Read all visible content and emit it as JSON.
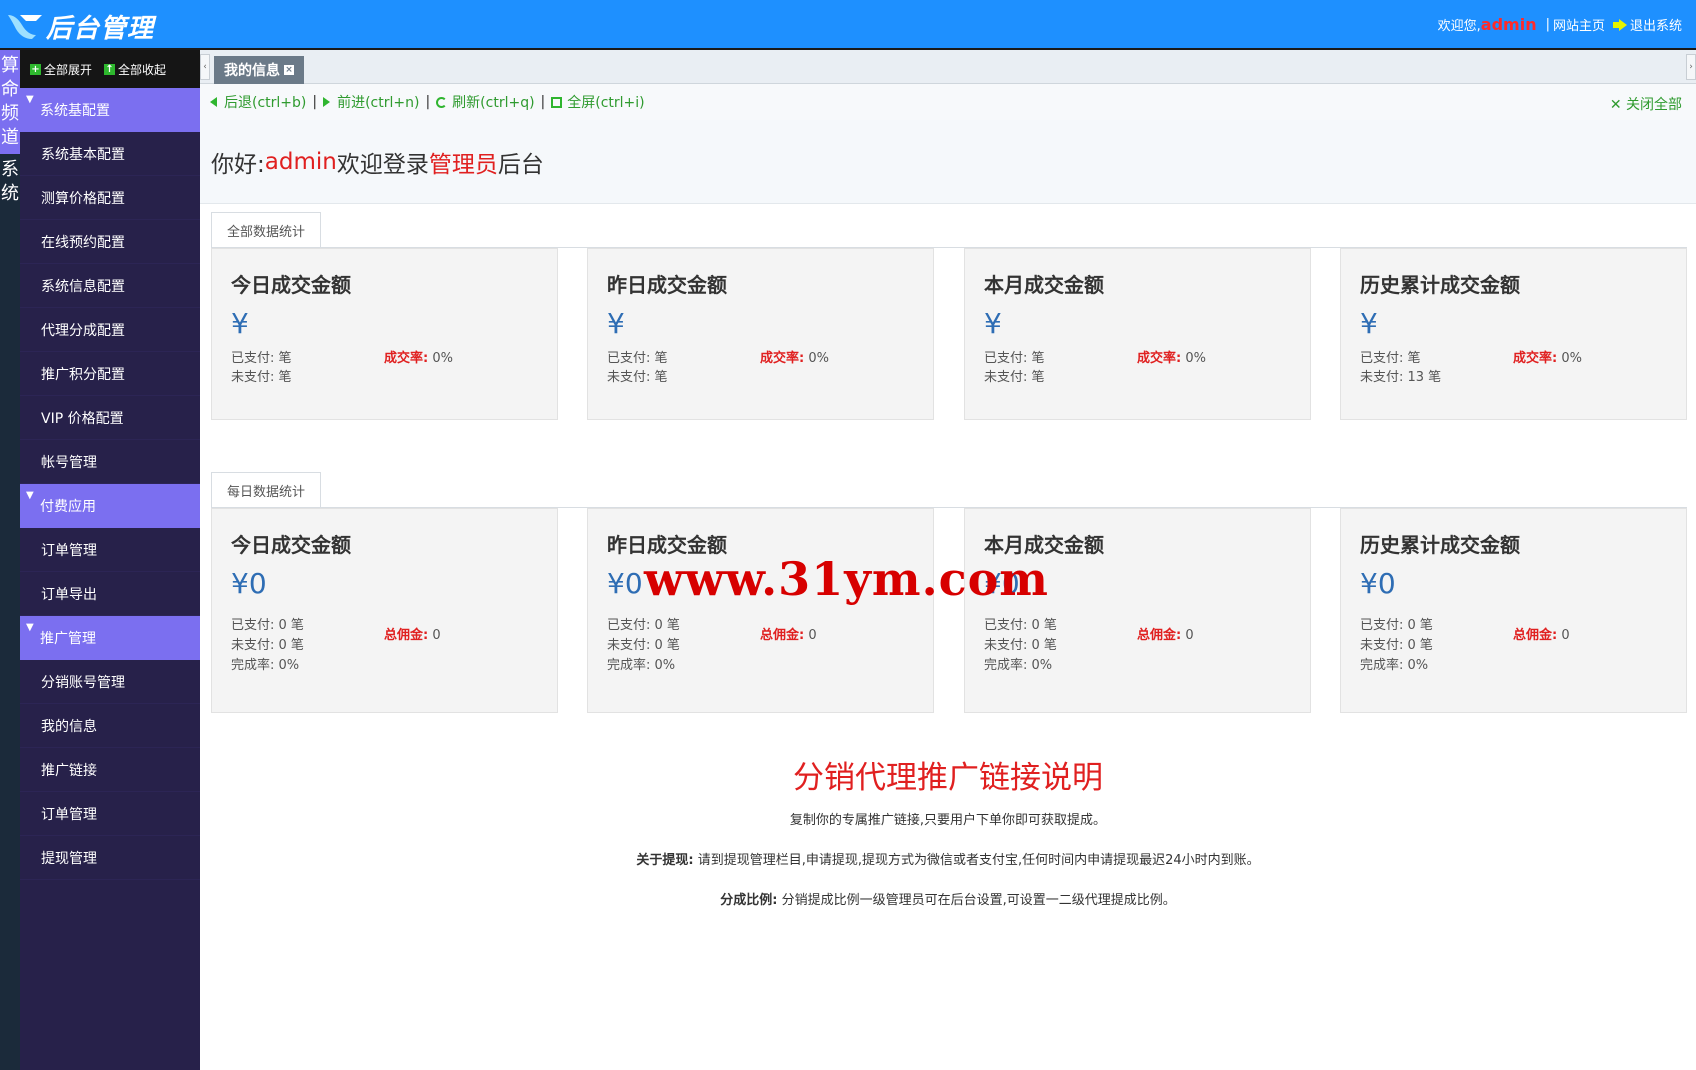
{
  "header": {
    "logo_text": "后台管理",
    "welcome_label": "欢迎您,",
    "username": "admin",
    "separator": "|",
    "home_link": "网站主页",
    "logout": "退出系统",
    "bg_color": "#1e90ff"
  },
  "vertical_tabs": [
    {
      "label": "算命频道",
      "active": true
    },
    {
      "label": "系统",
      "active": false
    }
  ],
  "sidebar": {
    "expand_all": "全部展开",
    "collapse_all": "全部收起",
    "groups": [
      {
        "title": "系统基配置",
        "items": [
          "系统基本配置",
          "测算价格配置",
          "在线预约配置",
          "系统信息配置",
          "代理分成配置",
          "推广积分配置",
          "VIP 价格配置",
          "帐号管理"
        ]
      },
      {
        "title": "付费应用",
        "items": [
          "订单管理",
          "订单导出"
        ]
      },
      {
        "title": "推广管理",
        "items": [
          "分销账号管理",
          "我的信息",
          "推广链接",
          "订单管理",
          "提现管理"
        ]
      }
    ]
  },
  "tabs": [
    {
      "label": "我的信息",
      "close": "×"
    }
  ],
  "toolbar": {
    "back": "后退(ctrl+b)",
    "forward": "前进(ctrl+n)",
    "refresh": "刷新(ctrl+q)",
    "fullscreen": "全屏(ctrl+i)",
    "close_all": "关闭全部",
    "bar": "|"
  },
  "welcome": {
    "prefix": "你好:",
    "user": "admin",
    "middle": "欢迎登录",
    "role": "管理员",
    "suffix": "后台"
  },
  "stats_all": {
    "tab": "全部数据统计",
    "cards": [
      {
        "title": "今日成交金额",
        "amount": "¥",
        "paid": "已支付: 笔",
        "unpaid": "未支付: 笔",
        "rate_label": "成交率:",
        "rate_value": " 0%"
      },
      {
        "title": "昨日成交金额",
        "amount": "¥",
        "paid": "已支付: 笔",
        "unpaid": "未支付: 笔",
        "rate_label": "成交率:",
        "rate_value": " 0%"
      },
      {
        "title": "本月成交金额",
        "amount": "¥",
        "paid": "已支付: 笔",
        "unpaid": "未支付: 笔",
        "rate_label": "成交率:",
        "rate_value": " 0%"
      },
      {
        "title": "历史累计成交金额",
        "amount": "¥",
        "paid": "已支付: 笔",
        "unpaid": "未支付: 13 笔",
        "rate_label": "成交率:",
        "rate_value": " 0%"
      }
    ]
  },
  "stats_daily": {
    "tab": "每日数据统计",
    "cards": [
      {
        "title": "今日成交金额",
        "amount": "¥0",
        "paid": "已支付: 0 笔",
        "unpaid": "未支付: 0 笔",
        "done": "完成率: 0%",
        "comm_label": "总佣金:",
        "comm_value": " 0"
      },
      {
        "title": "昨日成交金额",
        "amount": "¥0",
        "paid": "已支付: 0 笔",
        "unpaid": "未支付: 0 笔",
        "done": "完成率: 0%",
        "comm_label": "总佣金:",
        "comm_value": " 0"
      },
      {
        "title": "本月成交金额",
        "amount": "¥0",
        "paid": "已支付: 0 笔",
        "unpaid": "未支付: 0 笔",
        "done": "完成率: 0%",
        "comm_label": "总佣金:",
        "comm_value": " 0"
      },
      {
        "title": "历史累计成交金额",
        "amount": "¥0",
        "paid": "已支付: 0 笔",
        "unpaid": "未支付: 0 笔",
        "done": "完成率: 0%",
        "comm_label": "总佣金:",
        "comm_value": " 0"
      }
    ]
  },
  "promo": {
    "title": "分销代理推广链接说明",
    "line1": "复制你的专属推广链接,只要用户下单你即可获取提成。",
    "line2_label": "关于提现:",
    "line2_text": "请到提现管理栏目,申请提现,提现方式为微信或者支付宝,任何时间内申请提现最迟24小时内到账。",
    "line3_label": "分成比例:",
    "line3_text": "分销提成比例一级管理员可在后台设置,可设置一二级代理提成比例。"
  },
  "watermark": "www.31ym.com"
}
